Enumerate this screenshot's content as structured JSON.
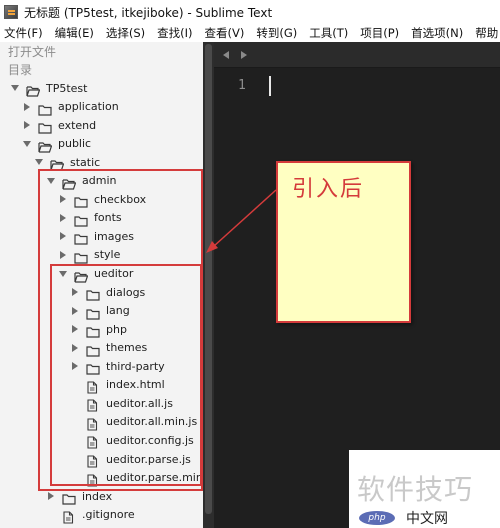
{
  "window": {
    "title": "无标题 (TP5test, itkejiboke) - Sublime Text",
    "icon": "sublime-text-icon"
  },
  "menu": {
    "items": [
      {
        "label": "文件(F)"
      },
      {
        "label": "编辑(E)"
      },
      {
        "label": "选择(S)"
      },
      {
        "label": "查找(I)"
      },
      {
        "label": "查看(V)"
      },
      {
        "label": "转到(G)"
      },
      {
        "label": "工具(T)"
      },
      {
        "label": "项目(P)"
      },
      {
        "label": "首选项(N)"
      },
      {
        "label": "帮助"
      }
    ]
  },
  "sidebar": {
    "open_files_label": "打开文件",
    "folders_label": "目录",
    "tree": [
      {
        "label": "TP5test",
        "type": "folder-open",
        "expanded": true
      },
      {
        "label": "application",
        "type": "folder",
        "expanded": false
      },
      {
        "label": "extend",
        "type": "folder",
        "expanded": false
      },
      {
        "label": "public",
        "type": "folder-open",
        "expanded": true
      },
      {
        "label": "static",
        "type": "folder-open",
        "expanded": true
      },
      {
        "label": "admin",
        "type": "folder-open",
        "expanded": true
      },
      {
        "label": "checkbox",
        "type": "folder",
        "expanded": false
      },
      {
        "label": "fonts",
        "type": "folder",
        "expanded": false
      },
      {
        "label": "images",
        "type": "folder",
        "expanded": false
      },
      {
        "label": "style",
        "type": "folder",
        "expanded": false
      },
      {
        "label": "ueditor",
        "type": "folder-open",
        "expanded": true
      },
      {
        "label": "dialogs",
        "type": "folder",
        "expanded": false
      },
      {
        "label": "lang",
        "type": "folder",
        "expanded": false
      },
      {
        "label": "php",
        "type": "folder",
        "expanded": false
      },
      {
        "label": "themes",
        "type": "folder",
        "expanded": false
      },
      {
        "label": "third-party",
        "type": "folder",
        "expanded": false
      },
      {
        "label": "index.html",
        "type": "file"
      },
      {
        "label": "ueditor.all.js",
        "type": "file"
      },
      {
        "label": "ueditor.all.min.js",
        "type": "file"
      },
      {
        "label": "ueditor.config.js",
        "type": "file"
      },
      {
        "label": "ueditor.parse.js",
        "type": "file"
      },
      {
        "label": "ueditor.parse.min.js",
        "type": "file"
      },
      {
        "label": "index",
        "type": "folder",
        "expanded": false
      },
      {
        "label": ".gitignore",
        "type": "file"
      }
    ]
  },
  "editor": {
    "line_number": "1",
    "background": "#1f1f1f"
  },
  "annotation": {
    "note_text": "引入后",
    "color": "#d43b3b",
    "note_bg": "#ffffc2"
  },
  "watermark": {
    "main_text": "软件技巧",
    "badge": "php",
    "site": "中文网"
  }
}
